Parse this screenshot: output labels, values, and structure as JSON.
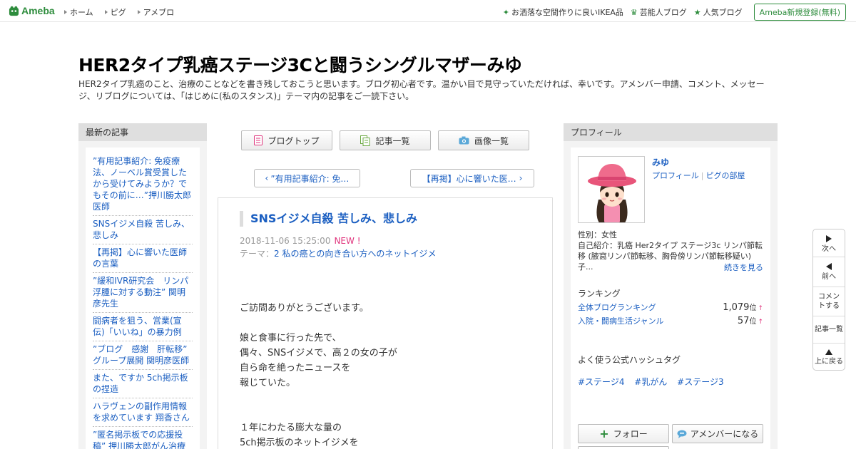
{
  "topbar": {
    "logo": "Ameba",
    "nav": [
      "ホーム",
      "ピグ",
      "アメブロ"
    ],
    "right_links": [
      {
        "label": "お洒落な空間作りに良いIKEA品",
        "icon": "sparkle-icon"
      },
      {
        "label": "芸能人ブログ",
        "icon": "crown-icon"
      },
      {
        "label": "人気ブログ",
        "icon": "star-icon"
      }
    ],
    "register": "Ameba新規登録(無料)"
  },
  "header": {
    "title": "HER2タイプ乳癌ステージ3Cと闘うシングルマザーみゆ",
    "description": "HER2タイプ乳癌のこと、治療のことなどを書き残しておこうと思います。ブログ初心者です。温かい目で見守っていただければ、幸いです。アメンバー申請、コメント、メッセージ、リブログについては、「はじめに(私のスタンス)」テーマ内の記事をご一読下さい。"
  },
  "left": {
    "heading": "最新の記事",
    "items": [
      "”有用記事紹介: 免疫療法、ノーベル賞受賞したから受けてみようか？でもその前に…”押川勝太郎医師",
      "SNSイジメ自殺 苦しみ、悲しみ",
      "【再掲】心に響いた医師の言葉",
      "”緩和IVR研究会　リンパ浮腫に対する動注” 関明彦先生",
      "闘病者を狙う、営業(宣伝)「いいね」の暴力例",
      "”ブログ　感謝　肝転移” グループ展開 関明彦医師",
      "また、ですか 5ch掲示板の捏造",
      "ハラヴェンの副作用情報を求めています 翔香さん",
      "”匿名掲示板での応援投稿” 押川勝太郎がん治療医"
    ]
  },
  "center": {
    "buttons": [
      {
        "label": "ブログトップ",
        "icon": "blog-top-icon"
      },
      {
        "label": "記事一覧",
        "icon": "article-list-icon"
      },
      {
        "label": "画像一覧",
        "icon": "camera-icon"
      }
    ],
    "prev": "”有用記事紹介: 免…",
    "next": "【再掲】心に響いた医…",
    "article": {
      "title": "SNSイジメ自殺 苦しみ、悲しみ",
      "date": "2018-11-06 15:25:00",
      "new_badge": "NEW !",
      "theme_label": "テーマ：",
      "theme": "2 私の癌との向き合い方へのネットイジメ",
      "body": [
        "ご訪問ありがとうございます。",
        "",
        "娘と食事に行った先で、",
        "偶々、SNSイジメで、高２の女の子が",
        "自ら命を絶ったニュースを",
        "報じていた。",
        "",
        "",
        "１年にわたる膨大な量の",
        "5ch掲示板のネットイジメを"
      ]
    }
  },
  "right": {
    "heading": "プロフィール",
    "name": "みゆ",
    "link_profile": "プロフィール",
    "link_pig": "ピグの部屋",
    "gender": "性別：女性",
    "intro": "自己紹介：乳癌 Her2タイプ ステージ3c リンパ節転移 (腋窩リンパ節転移、胸骨傍リンパ節転移疑い) 子...",
    "readmore": "続きを見る",
    "ranking_title": "ランキング",
    "rankings": [
      {
        "label": "全体ブログランキング",
        "value": "1,079",
        "unit": "位",
        "arrow": "↑"
      },
      {
        "label": "入院・闘病生活ジャンル",
        "value": "57",
        "unit": "位",
        "arrow": "↑"
      }
    ],
    "hashtag_title": "よく使う公式ハッシュタグ",
    "hashtags": [
      "#ステージ4",
      "#乳がん",
      "#ステージ3"
    ],
    "follow": "フォロー",
    "amember": "アメンバーになる"
  },
  "sidenav": {
    "next": "次へ",
    "prev": "前へ",
    "comment": "コメントする",
    "list": "記事一覧",
    "top": "上に戻る"
  },
  "colors": {
    "brand_green": "#2d8c3c",
    "link_blue": "#1a5ec1",
    "new_pink": "#e0347d"
  }
}
